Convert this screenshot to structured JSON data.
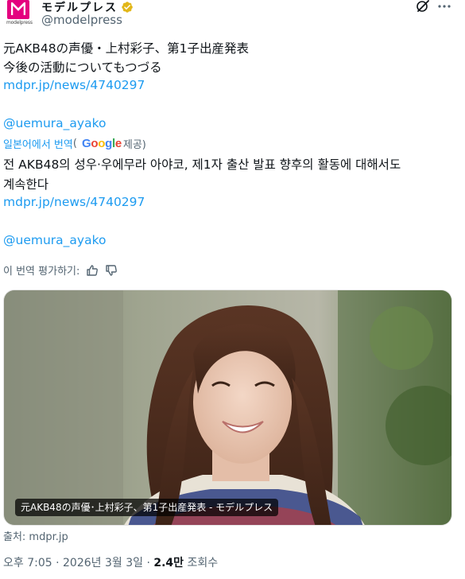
{
  "author": {
    "display_name": "モデルプレス",
    "handle": "@modelpress",
    "avatar_text": "modelpress",
    "verified": true,
    "brand_color": "#e4007f",
    "verified_color": "#e2b719"
  },
  "tweet": {
    "original_lines": [
      "元AKB48の声優・上村彩子、第1子出産発表",
      "今後の活動についてもつづる"
    ],
    "original_link": "mdpr.jp/news/4740297",
    "original_mention": "@uemura_ayako",
    "translated_by": "일본어에서 번역",
    "translated_google": "Google",
    "translated_provided": "제공)",
    "translated_open_paren": "(",
    "translated_lines": [
      "전 AKB48의 성우·우에무라 아야코, 제1자 출산 발표 향후의 활동에 대해서도",
      "계속한다"
    ],
    "translated_link": "mdpr.jp/news/4740297",
    "translated_mention": "@uemura_ayako",
    "rate_translation": "이 번역 평가하기:"
  },
  "media": {
    "caption": "元AKB48の声優･上村彩子、第1子出産発表 - モデルプレス",
    "source": "출처: mdpr.jp"
  },
  "meta": {
    "time": "오후 7:05",
    "date": "2026년 3월 3일",
    "views_count": "2.4만",
    "views_label": "조회수",
    "separator": "·"
  },
  "colors": {
    "link": "#1d9bf0",
    "secondary_text": "#536471",
    "primary_text": "#0f1419"
  },
  "icons": {
    "verified": "verified-badge-icon",
    "grok": "grok-icon",
    "more": "more-options-icon",
    "thumbs_up": "thumbs-up-icon",
    "thumbs_down": "thumbs-down-icon"
  }
}
